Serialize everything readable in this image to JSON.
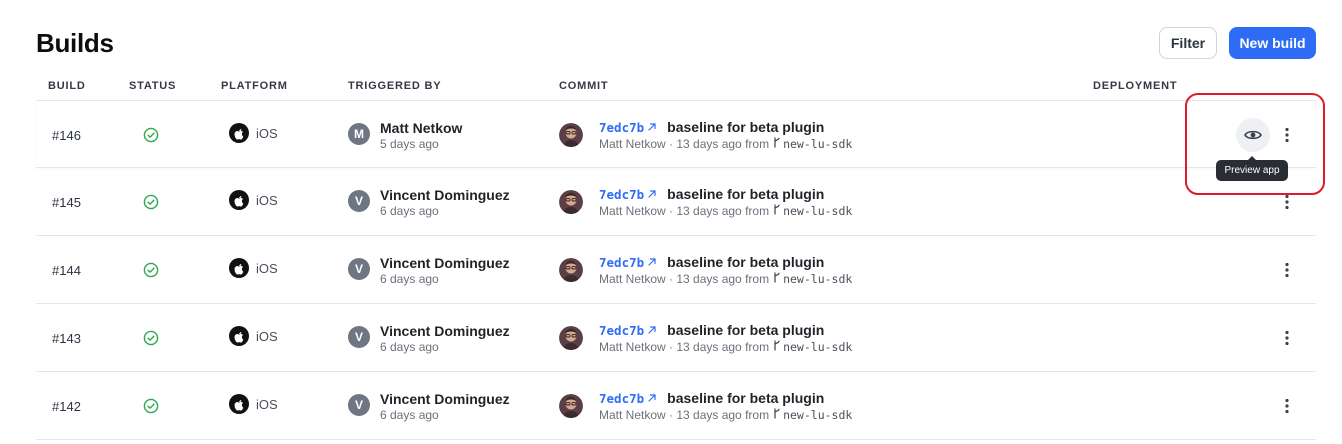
{
  "page": {
    "title": "Builds"
  },
  "toolbar": {
    "filter_label": "Filter",
    "new_build_label": "New build"
  },
  "columns": {
    "build": "BUILD",
    "status": "STATUS",
    "platform": "PLATFORM",
    "triggered_by": "TRIGGERED BY",
    "commit": "COMMIT",
    "deployment": "DEPLOYMENT"
  },
  "rows": [
    {
      "build": "#146",
      "status": "success",
      "platform": "iOS",
      "trigger_initial": "M",
      "trigger_name": "Matt Netkow",
      "trigger_time": "5 days ago",
      "sha": "7edc7b",
      "message": "baseline for beta plugin",
      "commit_meta": "Matt Netkow · 13 days ago from",
      "branch": "new-lu-sdk"
    },
    {
      "build": "#145",
      "status": "success",
      "platform": "iOS",
      "trigger_initial": "V",
      "trigger_name": "Vincent Dominguez",
      "trigger_time": "6 days ago",
      "sha": "7edc7b",
      "message": "baseline for beta plugin",
      "commit_meta": "Matt Netkow · 13 days ago from",
      "branch": "new-lu-sdk"
    },
    {
      "build": "#144",
      "status": "success",
      "platform": "iOS",
      "trigger_initial": "V",
      "trigger_name": "Vincent Dominguez",
      "trigger_time": "6 days ago",
      "sha": "7edc7b",
      "message": "baseline for beta plugin",
      "commit_meta": "Matt Netkow · 13 days ago from",
      "branch": "new-lu-sdk"
    },
    {
      "build": "#143",
      "status": "success",
      "platform": "iOS",
      "trigger_initial": "V",
      "trigger_name": "Vincent Dominguez",
      "trigger_time": "6 days ago",
      "sha": "7edc7b",
      "message": "baseline for beta plugin",
      "commit_meta": "Matt Netkow · 13 days ago from",
      "branch": "new-lu-sdk"
    },
    {
      "build": "#142",
      "status": "success",
      "platform": "iOS",
      "trigger_initial": "V",
      "trigger_name": "Vincent Dominguez",
      "trigger_time": "6 days ago",
      "sha": "7edc7b",
      "message": "baseline for beta plugin",
      "commit_meta": "Matt Netkow · 13 days ago from",
      "branch": "new-lu-sdk"
    }
  ],
  "tooltip": {
    "preview_app": "Preview app"
  },
  "icons": {
    "status": "check-circle-icon",
    "platform": "apple-icon",
    "commit_link": "external-link-icon",
    "branch": "git-branch-icon",
    "preview": "eye-icon",
    "row_menu": "kebab-menu-icon"
  },
  "colors": {
    "accent": "#2f6cf6",
    "success": "#2fa84f",
    "highlight": "#e0192b"
  }
}
